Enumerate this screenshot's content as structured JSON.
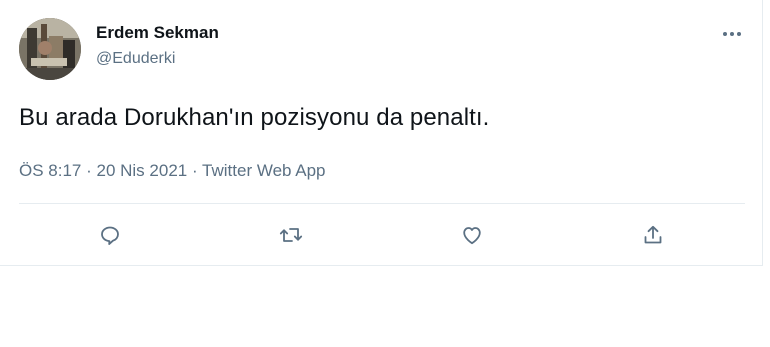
{
  "tweet": {
    "author_name": "Erdem Sekman",
    "author_handle": "@Eduderki",
    "text": "Bu arada Dorukhan'ın pozisyonu da penaltı.",
    "time": "ÖS 8:17",
    "separator": "·",
    "date": "20 Nis 2021",
    "source": "Twitter Web App"
  },
  "icons": {
    "more": "more-horizontal-icon",
    "reply": "reply-icon",
    "retweet": "retweet-icon",
    "like": "like-icon",
    "share": "share-icon"
  },
  "colors": {
    "text": "#0f1419",
    "secondary": "#5b7083",
    "icon": "#5b7083",
    "border": "#e6ecf0"
  }
}
